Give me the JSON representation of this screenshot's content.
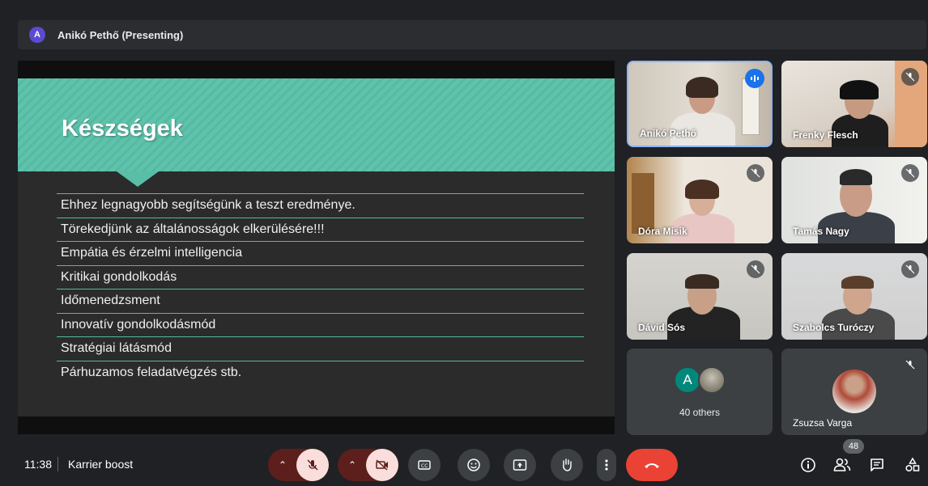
{
  "presenter_bar": {
    "avatar_letter": "A",
    "label": "Anikó Pethő (Presenting)"
  },
  "slide": {
    "title": "Készségek",
    "items": [
      "Ehhez legnagyobb segítségünk a teszt eredménye.",
      "Törekedjünk az általánosságok elkerülésére!!!",
      "Empátia és érzelmi intelligencia",
      "Kritikai gondolkodás",
      "Időmenedzsment",
      "Innovatív gondolkodásmód",
      "Stratégiai látásmód",
      "Párhuzamos feladatvégzés stb."
    ]
  },
  "participants": {
    "tiles": [
      {
        "name": "Anikó Pethő"
      },
      {
        "name": "Frenky Flesch"
      },
      {
        "name": "Dóra Misik"
      },
      {
        "name": "Tamás Nagy"
      },
      {
        "name": "Dávid Sós"
      },
      {
        "name": "Szabolcs Turóczy"
      }
    ],
    "others": {
      "avatar_letter": "A",
      "label": "40 others"
    },
    "last": {
      "name": "Zsuzsa Varga"
    }
  },
  "bottom_bar": {
    "time": "11:38",
    "meeting_name": "Karrier boost",
    "participant_count": "48"
  },
  "colors": {
    "accent_teal": "#5fc3ac",
    "hangup_red": "#ea4335",
    "speaking_blue": "#1a73e8"
  },
  "icons": [
    "mic-off-icon",
    "camera-off-icon",
    "captions-icon",
    "emoji-icon",
    "present-icon",
    "raise-hand-icon",
    "more-options-icon",
    "end-call-icon",
    "info-icon",
    "people-icon",
    "chat-icon",
    "activities-icon"
  ]
}
